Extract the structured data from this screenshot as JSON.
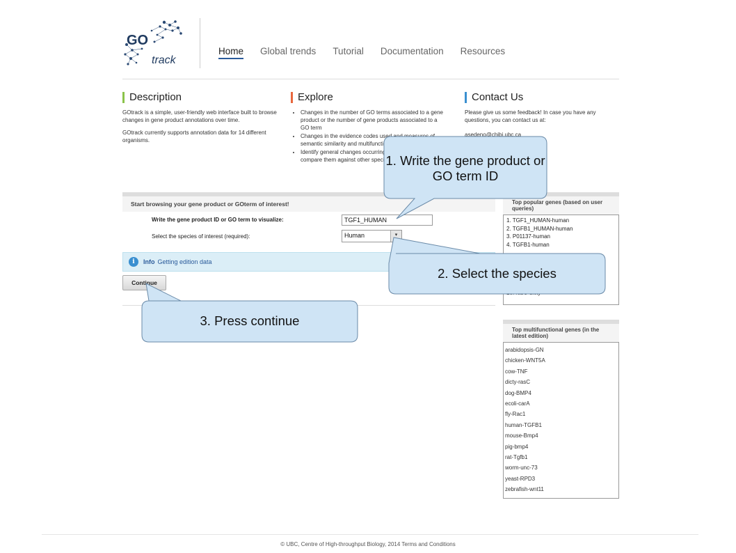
{
  "header": {
    "logo_text_go": "GO",
    "logo_text_track": "track",
    "nav": [
      {
        "label": "Home",
        "active": true
      },
      {
        "label": "Global trends",
        "active": false
      },
      {
        "label": "Tutorial",
        "active": false
      },
      {
        "label": "Documentation",
        "active": false
      },
      {
        "label": "Resources",
        "active": false
      }
    ]
  },
  "description": {
    "title": "Description",
    "p1": "GOtrack is a simple, user-friendly web interface built to browse changes in gene product annotations over time.",
    "p2": "GOtrack currently supports annotation data for 14 different organisms."
  },
  "explore": {
    "title": "Explore",
    "items": [
      "Changes in the number of GO terms associated to a gene product or the number of gene products associated to a GO term",
      "Changes in the evidence codes used and measures of semantic similarity and multifunctionality",
      "Identify general changes occurring in a species and compare them against other species"
    ]
  },
  "contact": {
    "title": "Contact Us",
    "text": "Please give us some feedback! In case you have any questions, you can contact us at:",
    "email": "asedeno@chibi.ubc.ca"
  },
  "browse": {
    "title": "Start browsing your gene product or GOterm of interest!",
    "gene_label": "Write the gene product ID or GO term to visualize:",
    "gene_value": "TGF1_HUMAN",
    "species_label": "Select the species of interest (required):",
    "species_value": "Human",
    "info_title": "Info",
    "info_text": "Getting edition data",
    "continue_label": "Continue"
  },
  "popular": {
    "title": "Top popular genes (based on user queries)",
    "items": [
      "1.  TGF1_HUMAN-human",
      "2.  TGFB1_HUMAN-human",
      "3.  P01137-human",
      "4.  TGFB1-human",
      "",
      "",
      "",
      "",
      "",
      "10.  rasC-dicty"
    ]
  },
  "multi": {
    "title": "Top multifunctional genes (in the latest edition)",
    "items": [
      "arabidopsis-GN",
      "chicken-WNT5A",
      "cow-TNF",
      "dicty-rasC",
      "dog-BMP4",
      "ecoli-carA",
      "fly-Rac1",
      "human-TGFB1",
      "mouse-Bmp4",
      "pig-bmp4",
      "rat-Tgfb1",
      "worm-unc-73",
      "yeast-RPD3",
      "zebrafish-wnt11"
    ]
  },
  "footer": {
    "text": "© UBC, Centre of High-throughput Biology, 2014 Terms and Conditions"
  },
  "callouts": {
    "c1": "1. Write the gene product or GO term ID",
    "c2": "2. Select the species",
    "c3": "3. Press continue"
  },
  "colors": {
    "accent_blue": "#2a5a9a",
    "callout_fill": "#cfe4f5",
    "description_bar": "#8bc34a",
    "explore_bar": "#e8663d",
    "contact_bar": "#3a8fd0"
  }
}
